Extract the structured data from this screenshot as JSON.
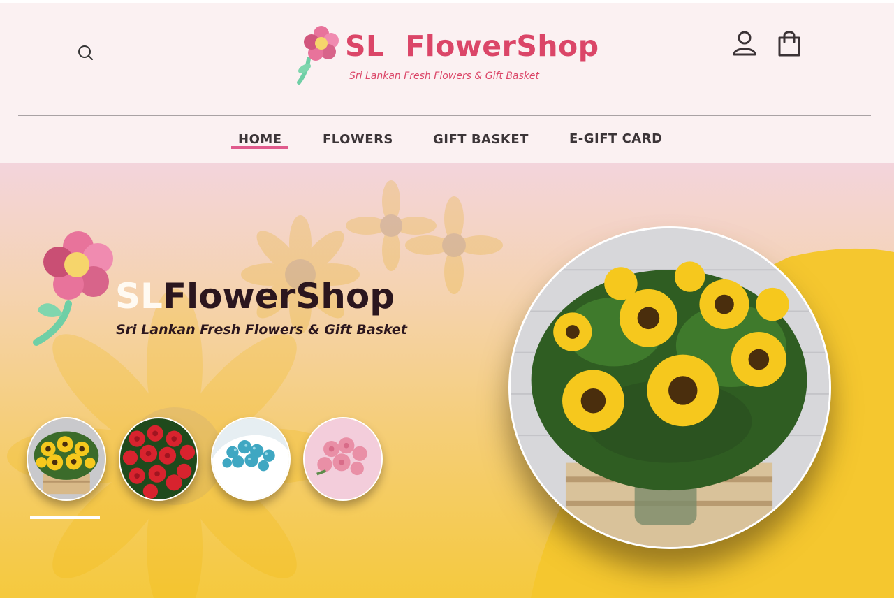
{
  "brand": {
    "name": "SL  FlowerShop",
    "tagline": "Sri Lankan Fresh Flowers & Gift Basket",
    "color": "#db4668"
  },
  "header": {
    "icons": {
      "search": "search-icon",
      "account": "user-icon",
      "cart": "shopping-bag-icon"
    }
  },
  "nav": {
    "items": [
      {
        "label": "HOME",
        "active": true
      },
      {
        "label": "FLOWERS",
        "active": false
      },
      {
        "label": "GIFT BASKET",
        "active": false
      },
      {
        "label": "E-GIFT CARD",
        "active": false
      }
    ],
    "active_color": "#e05a8c"
  },
  "hero": {
    "title_prefix": "SL",
    "title_main": "FlowerShop",
    "tagline": "Sri Lankan Fresh Flowers & Gift Basket",
    "thumbnails": [
      {
        "name": "sunflower-bouquet",
        "selected": true
      },
      {
        "name": "red-roses",
        "selected": false
      },
      {
        "name": "blue-flowers",
        "selected": false
      },
      {
        "name": "pink-roses",
        "selected": false
      }
    ],
    "featured_image": "sunflower-vase",
    "accent_color": "#f5c93d"
  }
}
